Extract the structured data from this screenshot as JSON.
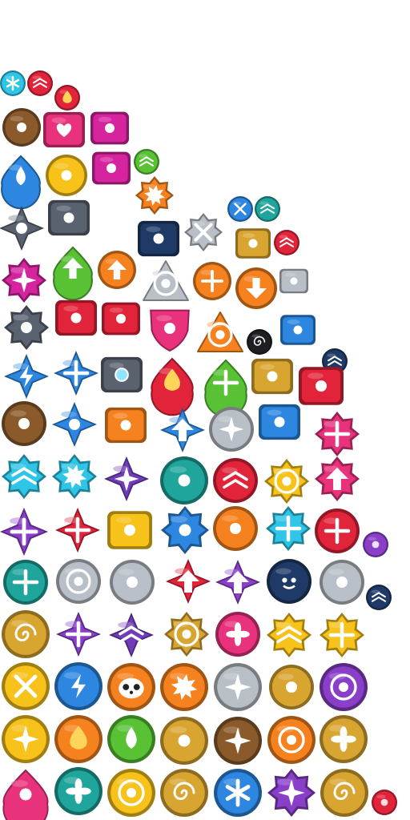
{
  "sheet": {
    "kind": "icon-sprite-atlas",
    "background": "#ffffff"
  },
  "colors": {
    "cyan": "#2ec5e6",
    "red": "#e2243a",
    "orange": "#f5821f",
    "pink": "#e8327c",
    "magenta": "#d6249f",
    "green": "#58c234",
    "yellow": "#f7c21a",
    "blue": "#2d86e0",
    "purple": "#8a3fc9",
    "violet": "#6f3db8",
    "slate": "#5a6270",
    "gold": "#d9a531",
    "silver": "#b8bfc7",
    "navy": "#1f3a66",
    "brown": "#8a5a2b",
    "teal": "#1fa59b",
    "black": "#1e1e24"
  },
  "icons": [
    {
      "name": "snowflake-icon",
      "color": "cyan",
      "shape": "round",
      "glyph": "snow"
    },
    {
      "name": "chevron-up-red-icon",
      "color": "red",
      "shape": "round",
      "glyph": "chev"
    },
    {
      "name": "fire-bomb-icon",
      "color": "red",
      "shape": "round",
      "glyph": "flame"
    },
    {
      "name": "yin-yang-gourd-icon",
      "color": "brown",
      "shape": "round",
      "glyph": "yin"
    },
    {
      "name": "heart-toolbox-icon",
      "color": "pink",
      "shape": "box",
      "glyph": "heart"
    },
    {
      "name": "fist-block-icon",
      "color": "magenta",
      "shape": "box",
      "glyph": "fist"
    },
    {
      "name": "water-drop-icon",
      "color": "blue",
      "shape": "drop",
      "glyph": "drop"
    },
    {
      "name": "bell-icon",
      "color": "yellow",
      "shape": "round",
      "glyph": "bell"
    },
    {
      "name": "pink-key-icon",
      "color": "magenta",
      "shape": "box",
      "glyph": "key"
    },
    {
      "name": "chevron-up-green-icon",
      "color": "green",
      "shape": "round",
      "glyph": "chev"
    },
    {
      "name": "double-blade-icon",
      "color": "slate",
      "shape": "diamond",
      "glyph": "blade"
    },
    {
      "name": "spiked-collar-icon",
      "color": "slate",
      "shape": "box",
      "glyph": "spike"
    },
    {
      "name": "orange-burst-icon",
      "color": "orange",
      "shape": "star",
      "glyph": "burst"
    },
    {
      "name": "cross-x-blue-icon",
      "color": "blue",
      "shape": "round",
      "glyph": "x"
    },
    {
      "name": "chevron-up-green2-icon",
      "color": "teal",
      "shape": "round",
      "glyph": "chev"
    },
    {
      "name": "steel-gauntlet-icon",
      "color": "navy",
      "shape": "box",
      "glyph": "gaunt"
    },
    {
      "name": "inward-arrows-icon",
      "color": "silver",
      "shape": "star",
      "glyph": "x"
    },
    {
      "name": "gold-crown-icon",
      "color": "gold",
      "shape": "box",
      "glyph": "crown"
    },
    {
      "name": "chevron-up-red2-icon",
      "color": "red",
      "shape": "round",
      "glyph": "chev"
    },
    {
      "name": "magenta-shuriken-icon",
      "color": "magenta",
      "shape": "star",
      "glyph": "star"
    },
    {
      "name": "green-up-arrow-icon",
      "color": "green",
      "shape": "drop",
      "glyph": "up"
    },
    {
      "name": "orange-up-swirl-icon",
      "color": "orange",
      "shape": "round",
      "glyph": "up"
    },
    {
      "name": "silver-target-icon",
      "color": "silver",
      "shape": "tri",
      "glyph": "target"
    },
    {
      "name": "orange-plus-icon",
      "color": "orange",
      "shape": "round",
      "glyph": "plus"
    },
    {
      "name": "orange-down-arrow-icon",
      "color": "orange",
      "shape": "round",
      "glyph": "down"
    },
    {
      "name": "silver-spine-icon",
      "color": "silver",
      "shape": "box",
      "glyph": "spine"
    },
    {
      "name": "dark-spiky-helm-icon",
      "color": "slate",
      "shape": "star",
      "glyph": "spike"
    },
    {
      "name": "red-hammer-icon",
      "color": "red",
      "shape": "box",
      "glyph": "hammer"
    },
    {
      "name": "red-canister-icon",
      "color": "red",
      "shape": "box",
      "glyph": "can"
    },
    {
      "name": "pink-shield-icon",
      "color": "pink",
      "shape": "shield",
      "glyph": "shield"
    },
    {
      "name": "orange-target-icon",
      "color": "orange",
      "shape": "tri",
      "glyph": "target"
    },
    {
      "name": "black-spiral-icon",
      "color": "black",
      "shape": "round",
      "glyph": "spiral"
    },
    {
      "name": "blue-key-icon",
      "color": "blue",
      "shape": "box",
      "glyph": "key"
    },
    {
      "name": "chevron-down-navy-icon",
      "color": "navy",
      "shape": "round",
      "glyph": "chev"
    },
    {
      "name": "blue-lightning-icon",
      "color": "blue",
      "shape": "diamond",
      "glyph": "bolt"
    },
    {
      "name": "blue-plus-bolt-icon",
      "color": "blue",
      "shape": "diamond",
      "glyph": "plus"
    },
    {
      "name": "robot-head-icon",
      "color": "slate",
      "shape": "box",
      "glyph": "eye"
    },
    {
      "name": "red-flame-icon",
      "color": "red",
      "shape": "drop",
      "glyph": "flame"
    },
    {
      "name": "green-plus-drop-icon",
      "color": "green",
      "shape": "drop",
      "glyph": "plus"
    },
    {
      "name": "gold-gauntlet-icon",
      "color": "gold",
      "shape": "box",
      "glyph": "gaunt"
    },
    {
      "name": "goggles-icon",
      "color": "red",
      "shape": "box",
      "glyph": "goggle"
    },
    {
      "name": "bun-hat-icon",
      "color": "brown",
      "shape": "round",
      "glyph": "hat"
    },
    {
      "name": "blue-crossbow-icon",
      "color": "blue",
      "shape": "diamond",
      "glyph": "bow"
    },
    {
      "name": "orange-cannon-icon",
      "color": "orange",
      "shape": "box",
      "glyph": "gun"
    },
    {
      "name": "blue-up-bolt-icon",
      "color": "blue",
      "shape": "diamond",
      "glyph": "up"
    },
    {
      "name": "silver-helm-icon",
      "color": "silver",
      "shape": "round",
      "glyph": "star"
    },
    {
      "name": "blue-boot-icon",
      "color": "blue",
      "shape": "box",
      "glyph": "boot"
    },
    {
      "name": "pink-burst-plus-icon",
      "color": "pink",
      "shape": "star",
      "glyph": "plus"
    },
    {
      "name": "cyan-star-chevron-icon",
      "color": "cyan",
      "shape": "star",
      "glyph": "chev"
    },
    {
      "name": "cyan-star-burst-icon",
      "color": "cyan",
      "shape": "star",
      "glyph": "burst"
    },
    {
      "name": "violet-sparkle-icon",
      "color": "violet",
      "shape": "diamond",
      "glyph": "spark"
    },
    {
      "name": "teal-core-icon",
      "color": "teal",
      "shape": "round",
      "glyph": "core"
    },
    {
      "name": "red-chevron-orb-icon",
      "color": "red",
      "shape": "round",
      "glyph": "chev"
    },
    {
      "name": "gold-gear-star-icon",
      "color": "yellow",
      "shape": "star",
      "glyph": "target"
    },
    {
      "name": "pink-up-burst-icon",
      "color": "pink",
      "shape": "star",
      "glyph": "up"
    },
    {
      "name": "purple-plus-star-icon",
      "color": "purple",
      "shape": "diamond",
      "glyph": "plus"
    },
    {
      "name": "red-plus-star-icon",
      "color": "red",
      "shape": "diamond",
      "glyph": "plus"
    },
    {
      "name": "scroll-icon",
      "color": "yellow",
      "shape": "box",
      "glyph": "scroll"
    },
    {
      "name": "blue-claw-icon",
      "color": "blue",
      "shape": "star",
      "glyph": "claw"
    },
    {
      "name": "bullet-icon",
      "color": "orange",
      "shape": "round",
      "glyph": "bullet"
    },
    {
      "name": "cyan-plus-star-icon",
      "color": "cyan",
      "shape": "star",
      "glyph": "plus"
    },
    {
      "name": "red-plus-flame-icon",
      "color": "red",
      "shape": "round",
      "glyph": "plus"
    },
    {
      "name": "purple-orb-bomb-icon",
      "color": "purple",
      "shape": "round",
      "glyph": "orb"
    },
    {
      "name": "teal-plus-ring-icon",
      "color": "teal",
      "shape": "round",
      "glyph": "plus"
    },
    {
      "name": "silver-ring-icon",
      "color": "silver",
      "shape": "round",
      "glyph": "target"
    },
    {
      "name": "silver-axe-icon",
      "color": "silver",
      "shape": "round",
      "glyph": "axe"
    },
    {
      "name": "red-up-star-icon",
      "color": "red",
      "shape": "diamond",
      "glyph": "up"
    },
    {
      "name": "purple-up-star-icon",
      "color": "purple",
      "shape": "diamond",
      "glyph": "up"
    },
    {
      "name": "demon-face-icon",
      "color": "navy",
      "shape": "round",
      "glyph": "face"
    },
    {
      "name": "silver-hook-icon",
      "color": "silver",
      "shape": "round",
      "glyph": "axe"
    },
    {
      "name": "chevron-up-navy-icon",
      "color": "navy",
      "shape": "round",
      "glyph": "chev"
    },
    {
      "name": "gold-swirl-ring-icon",
      "color": "gold",
      "shape": "round",
      "glyph": "spiral"
    },
    {
      "name": "purple-plus-diamond-icon",
      "color": "purple",
      "shape": "diamond",
      "glyph": "plus"
    },
    {
      "name": "violet-chevron-star-icon",
      "color": "violet",
      "shape": "diamond",
      "glyph": "chev"
    },
    {
      "name": "gold-target-star-icon",
      "color": "gold",
      "shape": "star",
      "glyph": "target"
    },
    {
      "name": "pink-propeller-icon",
      "color": "pink",
      "shape": "round",
      "glyph": "prop"
    },
    {
      "name": "gold-chevron-burst-icon",
      "color": "yellow",
      "shape": "star",
      "glyph": "chev"
    },
    {
      "name": "gold-plus-burst-icon",
      "color": "yellow",
      "shape": "star",
      "glyph": "plus"
    },
    {
      "name": "yellow-ring-cross-icon",
      "color": "yellow",
      "shape": "round",
      "glyph": "x"
    },
    {
      "name": "blue-bolt-ring-icon",
      "color": "blue",
      "shape": "round",
      "glyph": "bolt"
    },
    {
      "name": "panda-icon",
      "color": "orange",
      "shape": "round",
      "glyph": "panda"
    },
    {
      "name": "orange-sun-icon",
      "color": "orange",
      "shape": "round",
      "glyph": "burst"
    },
    {
      "name": "silver-moon-star-icon",
      "color": "silver",
      "shape": "round",
      "glyph": "star"
    },
    {
      "name": "sword-icon",
      "color": "gold",
      "shape": "round",
      "glyph": "sword"
    },
    {
      "name": "purple-compass-icon",
      "color": "purple",
      "shape": "round",
      "glyph": "target"
    },
    {
      "name": "gold-ring-star-icon",
      "color": "yellow",
      "shape": "round",
      "glyph": "star"
    },
    {
      "name": "fire-ring-icon",
      "color": "orange",
      "shape": "round",
      "glyph": "flame"
    },
    {
      "name": "green-leaf-drop-icon",
      "color": "green",
      "shape": "round",
      "glyph": "drop"
    },
    {
      "name": "gold-glyph-ring-icon",
      "color": "gold",
      "shape": "round",
      "glyph": "glyph"
    },
    {
      "name": "compass-star-icon",
      "color": "brown",
      "shape": "round",
      "glyph": "star"
    },
    {
      "name": "split-ring-icon",
      "color": "orange",
      "shape": "round",
      "glyph": "target"
    },
    {
      "name": "gold-pinwheel-icon",
      "color": "gold",
      "shape": "round",
      "glyph": "prop"
    },
    {
      "name": "pink-lotus-icon",
      "color": "pink",
      "shape": "drop",
      "glyph": "lotus"
    },
    {
      "name": "teal-swirl-icon",
      "color": "teal",
      "shape": "round",
      "glyph": "prop"
    },
    {
      "name": "gold-cog-icon",
      "color": "yellow",
      "shape": "round",
      "glyph": "target"
    },
    {
      "name": "gold-yin-icon",
      "color": "gold",
      "shape": "round",
      "glyph": "spiral"
    },
    {
      "name": "blue-snow-disc-icon",
      "color": "blue",
      "shape": "round",
      "glyph": "snow"
    },
    {
      "name": "dark-shuriken-icon",
      "color": "purple",
      "shape": "star",
      "glyph": "star"
    },
    {
      "name": "gold-vortex-icon",
      "color": "gold",
      "shape": "round",
      "glyph": "spiral"
    },
    {
      "name": "red-bomb-icon",
      "color": "red",
      "shape": "round",
      "glyph": "dot"
    }
  ]
}
